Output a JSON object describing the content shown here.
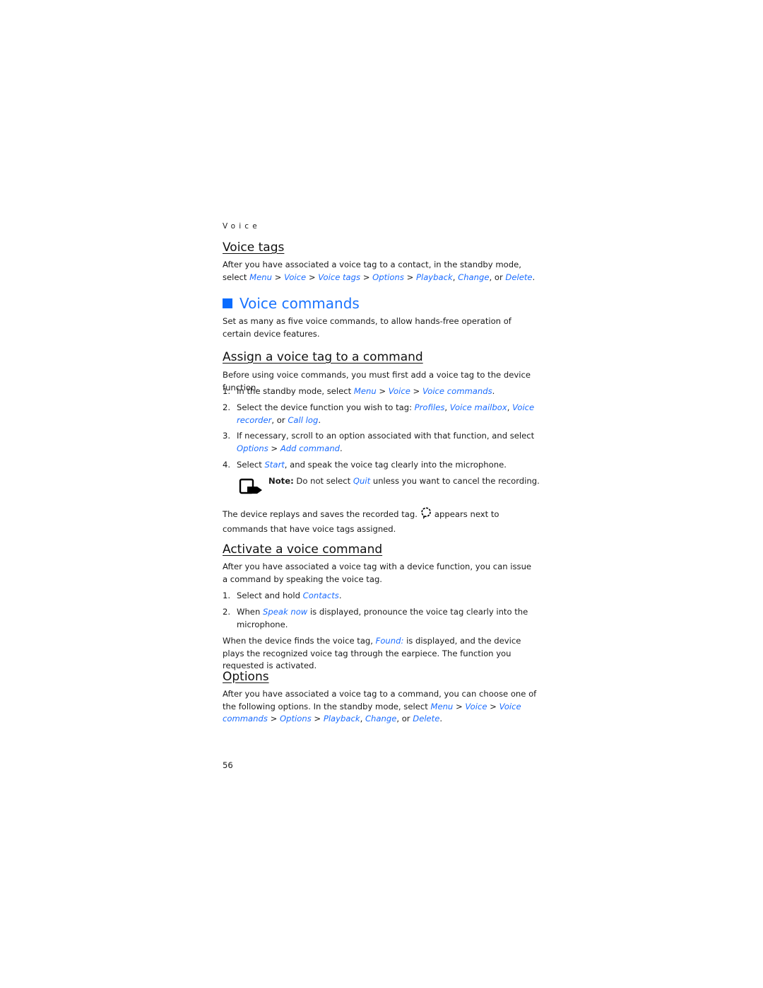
{
  "running_head": "Voice",
  "sections": {
    "voice_tags": {
      "heading": "Voice tags",
      "text_1": "After you have associated a voice tag to a contact, in the standby mode,",
      "text_2_prefix": "select ",
      "path": [
        "Menu",
        "Voice",
        "Voice tags",
        "Options",
        "Playback"
      ],
      "sep": " > ",
      "comma": ", ",
      "change": "Change",
      "or": ", or ",
      "delete": "Delete",
      "end": "."
    },
    "voice_commands": {
      "heading": "Voice commands",
      "intro": "Set as many as five voice commands, to allow hands-free operation of certain device features."
    },
    "assign": {
      "heading": "Assign a voice tag to a command",
      "intro": "Before using voice commands, you must first add a voice tag to the device function.",
      "steps": [
        {
          "num": "1.",
          "pre": "In the standby mode, select ",
          "links": [
            "Menu",
            "Voice",
            "Voice commands"
          ],
          "post": "."
        },
        {
          "num": "2.",
          "pre": "Select the device function you wish to tag: ",
          "links": [
            "Profiles",
            "Voice mailbox",
            "Voice recorder",
            "Call log"
          ],
          "post": "."
        },
        {
          "num": "3.",
          "pre": "If necessary, scroll to an option associated with that function, and select ",
          "links": [
            "Options",
            "Add command"
          ],
          "post": "."
        },
        {
          "num": "4.",
          "pre": "Select ",
          "links": [
            "Start"
          ],
          "post": ", and speak the voice tag clearly into the microphone."
        }
      ],
      "note": {
        "label": "Note:",
        "pre": " Do not select ",
        "link": "Quit",
        "post": " unless you want to cancel the recording."
      },
      "replay_pre": "The device replays and saves the recorded tag.",
      "replay_post": "appears next to commands that have voice tags assigned."
    },
    "activate": {
      "heading": "Activate a voice command",
      "intro": "After you have associated a voice tag with a device function, you can issue a command by speaking the voice tag.",
      "steps": [
        {
          "num": "1.",
          "pre": "Select and hold ",
          "link": "Contacts",
          "post": "."
        },
        {
          "num": "2.",
          "pre": "When ",
          "link": "Speak now",
          "post": " is displayed, pronounce the voice tag clearly into the microphone."
        }
      ],
      "found_pre": "When the device finds the voice tag, ",
      "found_link": "Found:",
      "found_post": " is displayed, and the device plays the recognized voice tag through the earpiece. The function you requested is activated."
    },
    "options": {
      "heading": "Options",
      "pre": "After you have associated a voice tag to a command, you can choose one of the following options. In the standby mode, select ",
      "path": [
        "Menu",
        "Voice",
        "Voice commands",
        "Options",
        "Playback"
      ],
      "change": "Change",
      "delete": "Delete"
    }
  },
  "page_number": "56",
  "colors": {
    "link": "#1a6cff",
    "heading_accent": "#0a6cff"
  }
}
